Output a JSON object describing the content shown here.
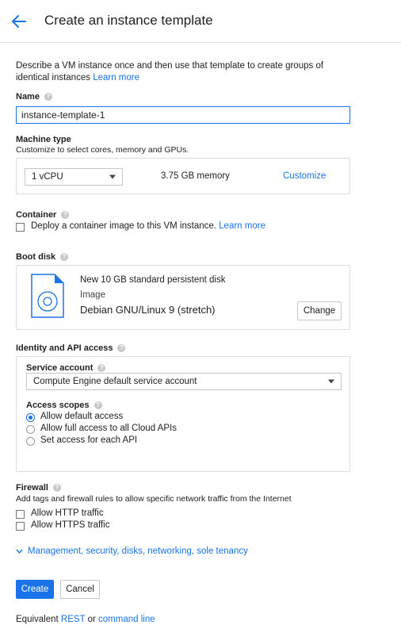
{
  "header": {
    "title": "Create an instance template"
  },
  "intro": {
    "text": "Describe a VM instance once and then use that template to create groups of",
    "text2": "identical instances",
    "learn_more": "Learn more"
  },
  "name": {
    "label": "Name",
    "value": "instance-template-1"
  },
  "machine_type": {
    "label": "Machine type",
    "description": "Customize to select cores, memory and GPUs.",
    "cores": "1 vCPU",
    "memory": "3.75 GB memory",
    "customize": "Customize"
  },
  "container": {
    "label": "Container",
    "checkbox_label": "Deploy a container image to this VM instance.",
    "learn_more": "Learn more"
  },
  "boot_disk": {
    "label": "Boot disk",
    "disk_desc": "New 10 GB standard persistent disk",
    "image_label": "Image",
    "image_name": "Debian GNU/Linux 9 (stretch)",
    "change": "Change"
  },
  "identity": {
    "label": "Identity and API access",
    "service_account_label": "Service account",
    "service_account_value": "Compute Engine default service account",
    "access_scopes_label": "Access scopes",
    "scopes": [
      {
        "label": "Allow default access",
        "selected": true
      },
      {
        "label": "Allow full access to all Cloud APIs",
        "selected": false
      },
      {
        "label": "Set access for each API",
        "selected": false
      }
    ]
  },
  "firewall": {
    "label": "Firewall",
    "description": "Add tags and firewall rules to allow specific network traffic from the Internet",
    "http": "Allow HTTP traffic",
    "https": "Allow HTTPS traffic"
  },
  "management": {
    "link": "Management, security, disks, networking, sole tenancy"
  },
  "actions": {
    "create": "Create",
    "cancel": "Cancel"
  },
  "footer": {
    "prefix": "Equivalent",
    "rest": "REST",
    "or": "or",
    "command_line": "command line"
  },
  "colors": {
    "accent": "#1a73e8",
    "border": "#dadce0"
  }
}
